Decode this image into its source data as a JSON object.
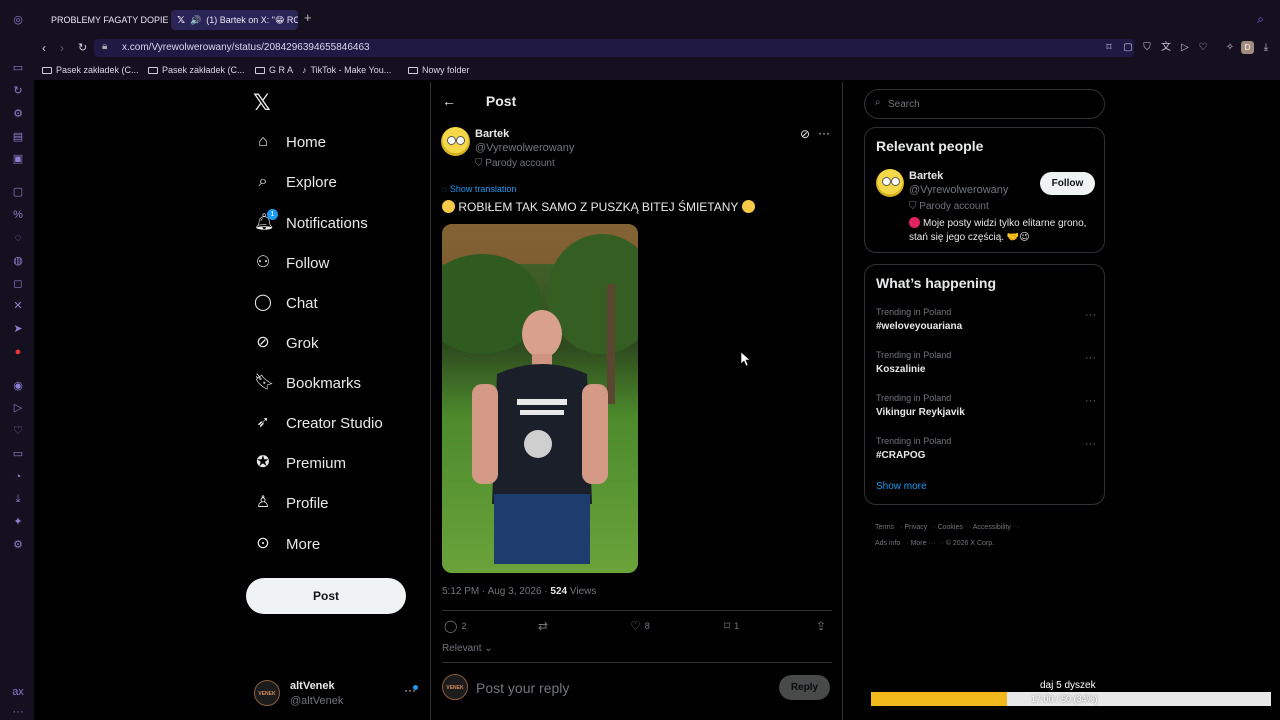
{
  "browser": {
    "tabs": [
      {
        "label": "PROBLEMY FAGATY DOPIE"
      },
      {
        "label": "(1) Bartek on X: \"😁 RO"
      }
    ],
    "url": "x.com/Vyrewolwerowany/status/2084296394655846463",
    "bookmarks": [
      "Pasek zakładek (C...",
      "Pasek zakładek (C...",
      "G R A",
      "TikTok - Make You...",
      "Nowy folder"
    ]
  },
  "nav": {
    "items": [
      {
        "label": "Home",
        "icon": "home-icon"
      },
      {
        "label": "Explore",
        "icon": "search-icon"
      },
      {
        "label": "Notifications",
        "icon": "bell-icon",
        "badge": "1"
      },
      {
        "label": "Follow",
        "icon": "person-plus-icon"
      },
      {
        "label": "Chat",
        "icon": "chat-icon"
      },
      {
        "label": "Grok",
        "icon": "grok-icon"
      },
      {
        "label": "Bookmarks",
        "icon": "bookmark-icon"
      },
      {
        "label": "Creator Studio",
        "icon": "rocket-icon"
      },
      {
        "label": "Premium",
        "icon": "verified-icon"
      },
      {
        "label": "Profile",
        "icon": "person-icon"
      },
      {
        "label": "More",
        "icon": "more-circle-icon"
      }
    ],
    "post_button": "Post"
  },
  "account": {
    "name": "altVenek",
    "handle": "@altVenek",
    "avatar_text": "VENEK"
  },
  "post": {
    "header": "Post",
    "author_name": "Bartek",
    "author_handle": "@Vyrewolwerowany",
    "parody_label": "Parody account",
    "show_translation": "Show translation",
    "text": "ROBIŁEM TAK SAMO Z PUSZKĄ BITEJ ŚMIETANY",
    "time": "5:12 PM · Aug 3, 2026 · ",
    "views_count": "524",
    "views_label": " Views",
    "replies": "2",
    "likes": "8",
    "bookmarks": "1",
    "sort_label": "Relevant",
    "reply_placeholder": "Post your reply",
    "reply_button": "Reply"
  },
  "sidebar": {
    "search_placeholder": "Search",
    "relevant_title": "Relevant people",
    "person": {
      "name": "Bartek",
      "handle": "@Vyrewolwerowany",
      "parody": "Parody account",
      "bio": "Moje posty widzi tylko elitarne grono, stań się jego częścią. 🤝😉",
      "follow": "Follow"
    },
    "happening_title": "What’s happening",
    "trends": [
      {
        "context": "Trending in Poland",
        "title": "#weloveyouariana"
      },
      {
        "context": "Trending in Poland",
        "title": "Koszalinie"
      },
      {
        "context": "Trending in Poland",
        "title": "Vikingur Reykjavik"
      },
      {
        "context": "Trending in Poland",
        "title": "#CRAPOG"
      }
    ],
    "show_more": "Show more",
    "footer": [
      "Terms",
      "Privacy",
      "Cookies",
      "Accessibility",
      "Ads info",
      "More ···",
      "© 2026 X Corp."
    ]
  },
  "overlay": {
    "label": "daj 5 dyszek",
    "progress_text": "17.00 / 50 (34%)",
    "progress_fraction": 0.34
  },
  "colors": {
    "accent": "#1d9bf0",
    "progress": "#f0b81a",
    "browser": "#15101f"
  }
}
